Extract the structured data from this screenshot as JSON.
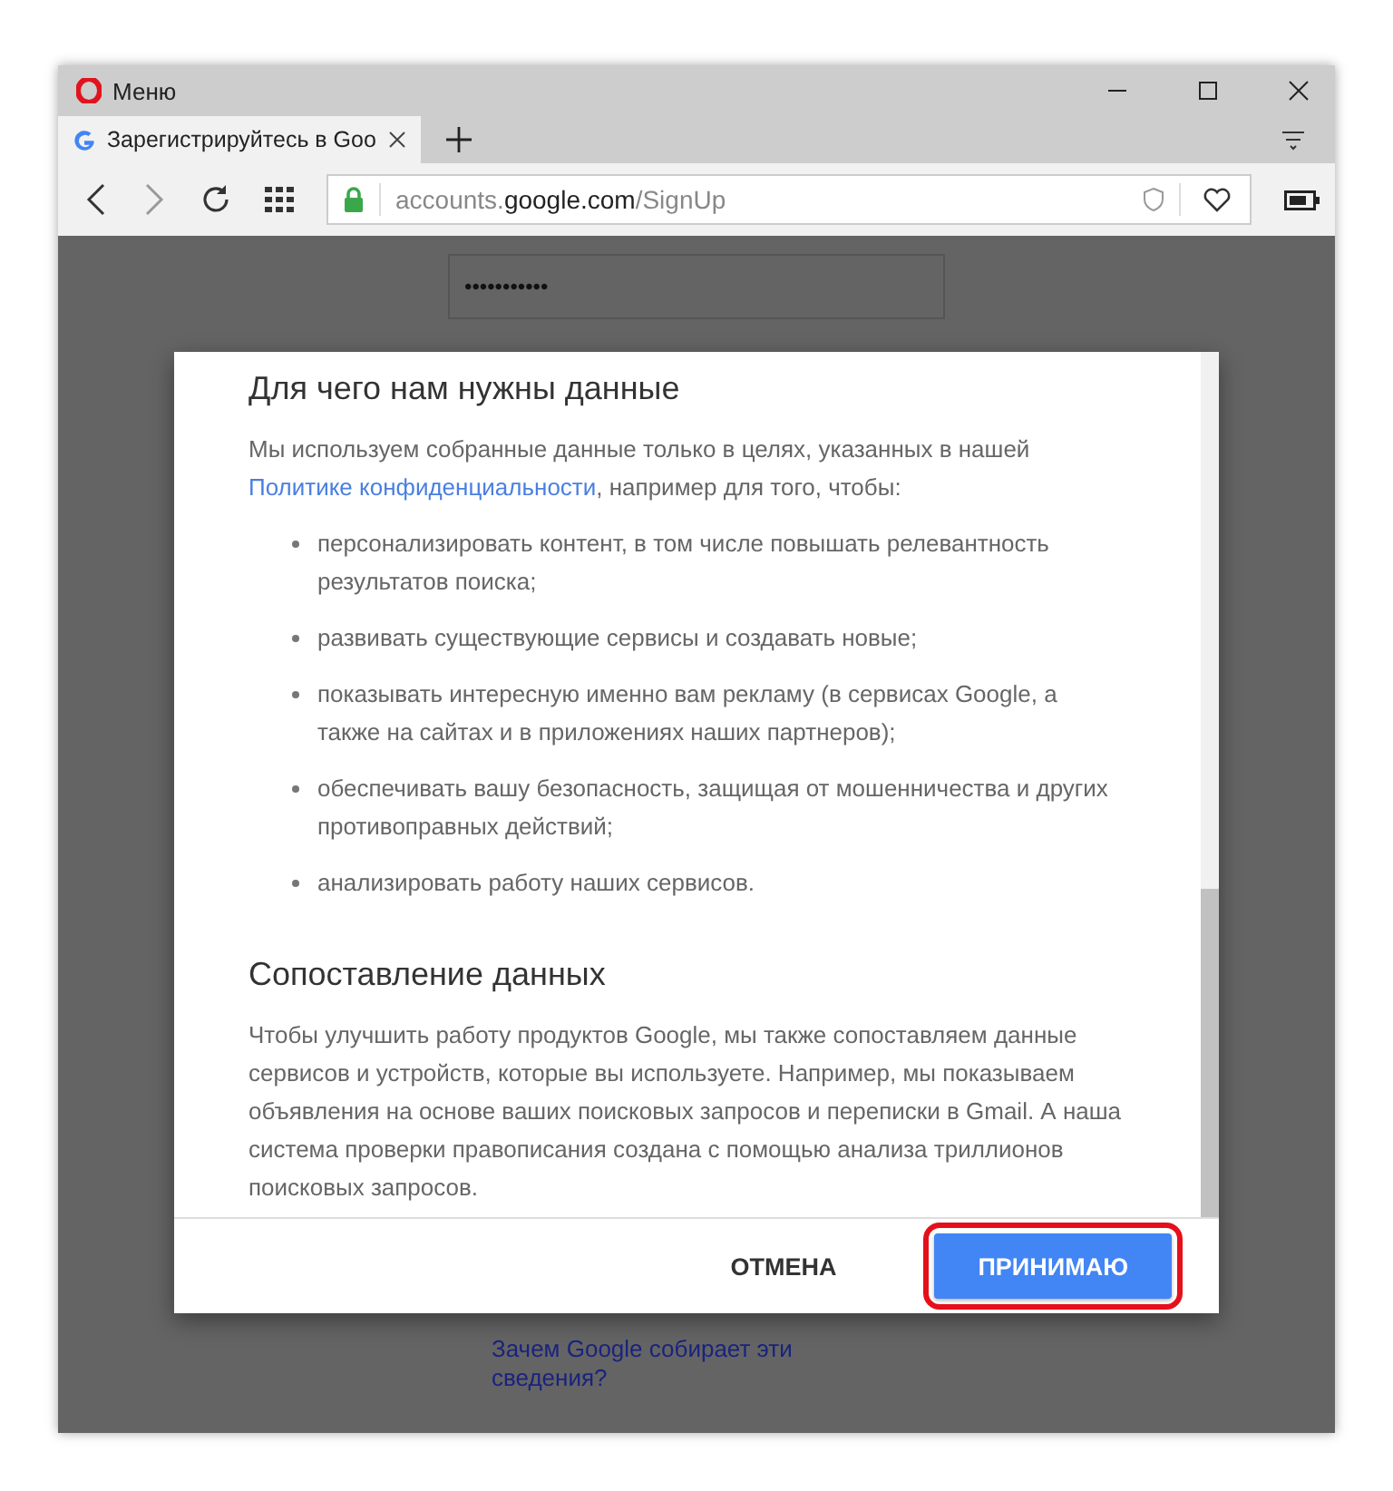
{
  "browser": {
    "menu_label": "Меню",
    "tab": {
      "title": "Зарегистрируйтесь в Goo",
      "selected": true
    },
    "address": {
      "host_prefix": "accounts.",
      "host": "google.com",
      "path": "/SignUp"
    }
  },
  "page": {
    "password_dots": "•••••••••••",
    "help_link": "Зачем Google собирает эти сведения?"
  },
  "dialog": {
    "sections": [
      {
        "heading": "Для чего нам нужны данные",
        "intro_before": "Мы используем собранные данные только в целях, указанных в нашей ",
        "intro_link": "Политике конфиденциальности",
        "intro_after": ", например для того, чтобы:",
        "bullets": [
          "персонализировать контент, в том числе повышать релевантность результатов поиска;",
          "развивать существующие сервисы и создавать новые;",
          "показывать интересную именно вам рекламу (в сервисах Google, а также на сайтах и в приложениях наших партнеров);",
          "обеспечивать вашу безопасность, защищая от мошенничества и других противоправных действий;",
          "анализировать работу наших сервисов."
        ]
      },
      {
        "heading": "Сопоставление данных",
        "intro_before": "Чтобы улучшить работу продуктов Google, мы также сопоставляем данные сервисов и устройств, которые вы используете. Например, мы показываем объявления на основе ваших поисковых запросов и переписки в Gmail. А наша система проверки правописания создана с помощью анализа триллионов поисковых запросов."
      }
    ],
    "buttons": [
      {
        "label": "ОТМЕНА",
        "kind": "text",
        "highlighted": false
      },
      {
        "label": "ПРИНИМАЮ",
        "kind": "primary",
        "highlighted": true
      }
    ]
  }
}
